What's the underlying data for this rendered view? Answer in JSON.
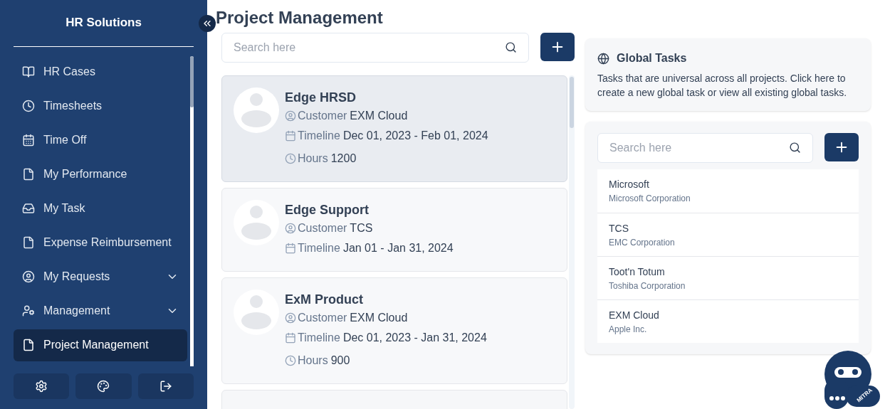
{
  "sidebar": {
    "brand": "HR Solutions",
    "items": [
      {
        "label": "HR Cases",
        "expandable": false,
        "selected": false
      },
      {
        "label": "Timesheets",
        "expandable": false,
        "selected": false
      },
      {
        "label": "Time Off",
        "expandable": false,
        "selected": false
      },
      {
        "label": "My Performance",
        "expandable": false,
        "selected": false
      },
      {
        "label": "My Task",
        "expandable": false,
        "selected": false
      },
      {
        "label": "Expense Reimbursement",
        "expandable": false,
        "selected": false
      },
      {
        "label": "My Requests",
        "expandable": true,
        "selected": false
      },
      {
        "label": "Management",
        "expandable": true,
        "selected": false
      },
      {
        "label": "Project Management",
        "expandable": false,
        "selected": true
      }
    ]
  },
  "page_title": "Project Management",
  "project_search": {
    "placeholder": "Search here"
  },
  "projects": [
    {
      "name": "Edge HRSD",
      "selected": true,
      "fields": [
        {
          "kind": "customer",
          "label": "Customer",
          "value": "EXM Cloud"
        },
        {
          "kind": "timeline",
          "label": "Timeline",
          "value": "Dec 01, 2023 - Feb 01, 2024"
        },
        {
          "kind": "hours",
          "label": "Hours",
          "value": "1200"
        }
      ]
    },
    {
      "name": "Edge Support",
      "selected": false,
      "fields": [
        {
          "kind": "customer",
          "label": "Customer",
          "value": "TCS"
        },
        {
          "kind": "timeline",
          "label": "Timeline",
          "value": "Jan 01 - Jan 31, 2024"
        }
      ]
    },
    {
      "name": "ExM Product",
      "selected": false,
      "fields": [
        {
          "kind": "customer",
          "label": "Customer",
          "value": "EXM Cloud"
        },
        {
          "kind": "timeline",
          "label": "Timeline",
          "value": "Dec 01, 2023 - Jan 31, 2024"
        },
        {
          "kind": "hours",
          "label": "Hours",
          "value": "900"
        }
      ]
    }
  ],
  "global_tasks": {
    "title": "Global Tasks",
    "description": "Tasks that are universal across all projects. Click here to create a new global task or view all existing global tasks."
  },
  "customer_search": {
    "placeholder": "Search here"
  },
  "customers": [
    {
      "name": "Microsoft",
      "company": "Microsoft Corporation"
    },
    {
      "name": "TCS",
      "company": "EMC Corporation"
    },
    {
      "name": "Toot'n Totum",
      "company": "Toshiba Corporation"
    },
    {
      "name": "EXM Cloud",
      "company": "Apple Inc."
    }
  ],
  "assistant": {
    "badge": "MITRA"
  }
}
